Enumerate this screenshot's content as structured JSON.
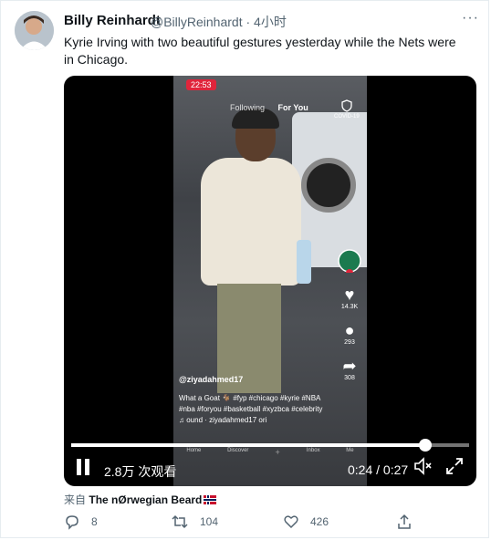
{
  "tweet": {
    "author_name": "Billy Reinhardt",
    "author_handle": "@BillyReinhardt",
    "separator": "·",
    "time_ago": "4小时",
    "text": "Kyrie Irving with two beautiful gestures yesterday while the Nets were in Chicago.",
    "source_prefix": "来自",
    "source_name": "The nØrwegian Beard"
  },
  "video": {
    "views": "2.8万 次观看",
    "time": "0:24 / 0:27",
    "progress": 0.889,
    "tiktok": {
      "clock": "22:53",
      "tab_following": "Following",
      "tab_foryou": "For You",
      "covid_label": "COVID-19",
      "likes": "14.3K",
      "comments": "293",
      "shares": "308",
      "username": "@ziyadahmed17",
      "caption": "What a Goat 🐐 #fyp #chicago #kyrie #NBA #nba #foryou #basketball #xyzbca #celebrity",
      "sound": "♫ ound · ziyadahmed17   ori",
      "nav": [
        "Home",
        "Discover",
        "",
        "Inbox",
        "Me"
      ]
    }
  },
  "actions": {
    "replies": "8",
    "retweets": "104",
    "likes": "426"
  },
  "colors": {
    "text_primary": "#0f1419",
    "text_secondary": "#536471",
    "border": "#e6ecf0",
    "tiktok_red": "#e0243b"
  }
}
